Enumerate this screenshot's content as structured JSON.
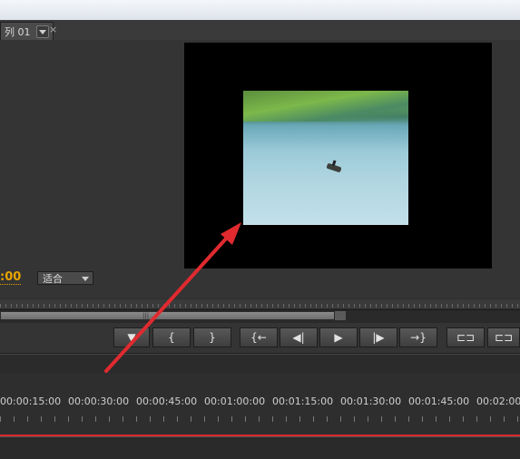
{
  "tab": {
    "label": "列 01",
    "close": "×"
  },
  "monitor": {
    "timecode": ":00",
    "zoom_select": "适合"
  },
  "controls": [
    {
      "name": "add-marker-button",
      "glyph": "▼"
    },
    {
      "name": "mark-in-button",
      "glyph": "{"
    },
    {
      "name": "mark-out-button",
      "glyph": "}"
    },
    {
      "name": "go-to-in-button",
      "glyph": "{←"
    },
    {
      "name": "step-back-button",
      "glyph": "◀|"
    },
    {
      "name": "play-button",
      "glyph": "▶"
    },
    {
      "name": "step-forward-button",
      "glyph": "|▶"
    },
    {
      "name": "go-to-out-button",
      "glyph": "→}"
    },
    {
      "name": "lift-button",
      "glyph": "⊏⊐"
    },
    {
      "name": "extract-button",
      "glyph": "⊏⊐"
    }
  ],
  "timeline": {
    "timecodes": [
      "00:00:15:00",
      "00:00:30:00",
      "00:00:45:00",
      "00:01:00:00",
      "00:01:15:00",
      "00:01:30:00",
      "00:01:45:00",
      "00:02:00:"
    ]
  },
  "colors": {
    "timecode": "#e8a400",
    "annotation_arrow": "#e02a2f",
    "playhead_line": "#d8282a"
  }
}
